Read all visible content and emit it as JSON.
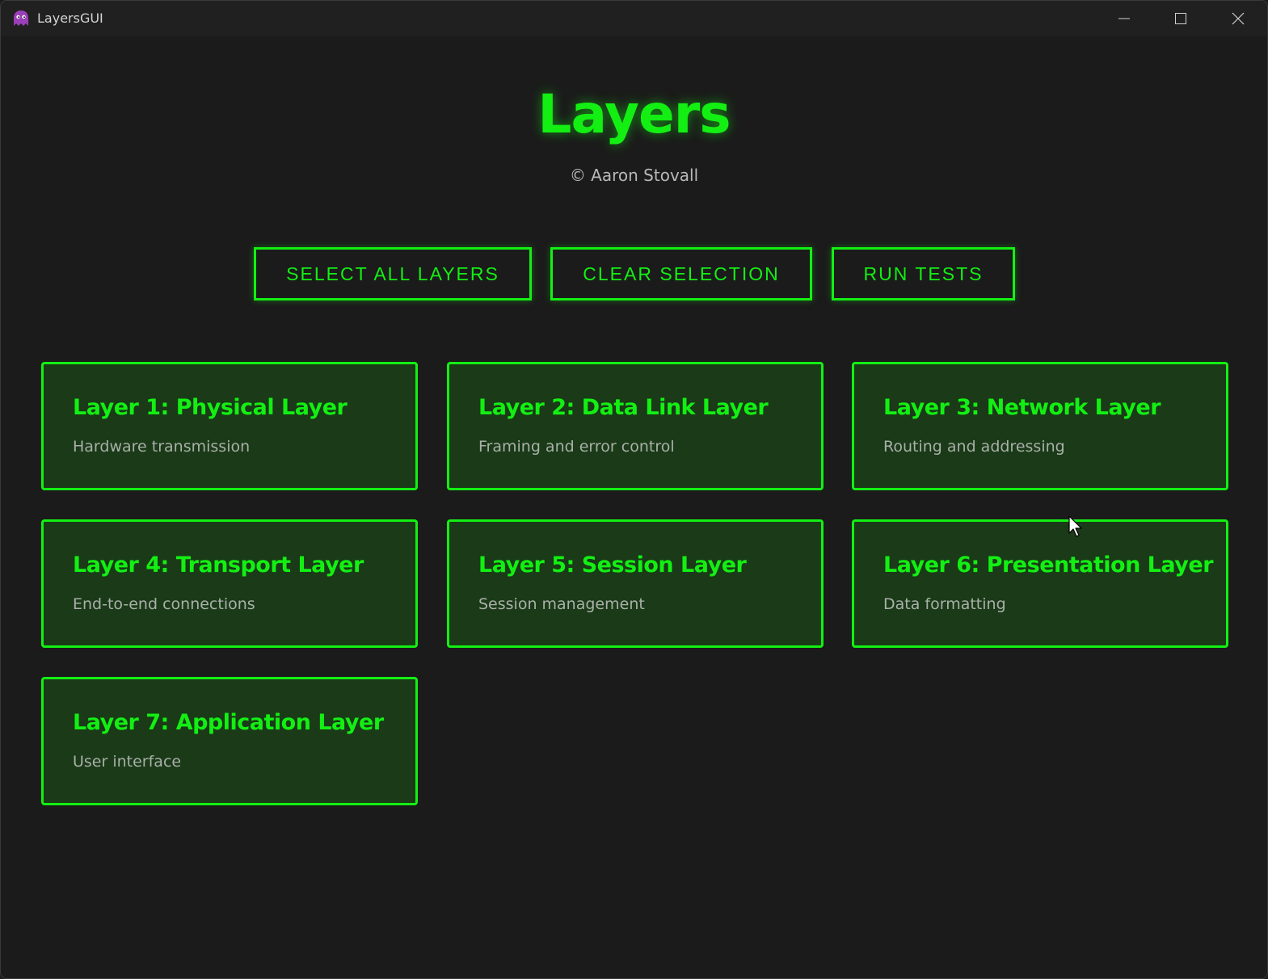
{
  "window": {
    "title": "LayersGUI",
    "app_icon": "app-logo-icon",
    "controls": [
      "minimize-icon",
      "maximize-icon",
      "close-icon"
    ]
  },
  "header": {
    "title": "Layers",
    "subtitle": "© Aaron Stovall"
  },
  "actions": {
    "select_all": "SELECT ALL LAYERS",
    "clear_selection": "CLEAR SELECTION",
    "run_tests": "RUN TESTS"
  },
  "layers": [
    {
      "title": "Layer 1: Physical Layer",
      "description": "Hardware transmission"
    },
    {
      "title": "Layer 2: Data Link Layer",
      "description": "Framing and error control"
    },
    {
      "title": "Layer 3: Network Layer",
      "description": "Routing and addressing"
    },
    {
      "title": "Layer 4: Transport Layer",
      "description": "End-to-end connections"
    },
    {
      "title": "Layer 5: Session Layer",
      "description": "Session management"
    },
    {
      "title": "Layer 6: Presentation Layer",
      "description": "Data formatting"
    },
    {
      "title": "Layer 7: Application Layer",
      "description": "User interface"
    }
  ],
  "colors": {
    "accent": "#13ef13",
    "background": "#1b1b1b",
    "card_background": "#1a3a18",
    "muted_text": "#a9b0a8"
  }
}
